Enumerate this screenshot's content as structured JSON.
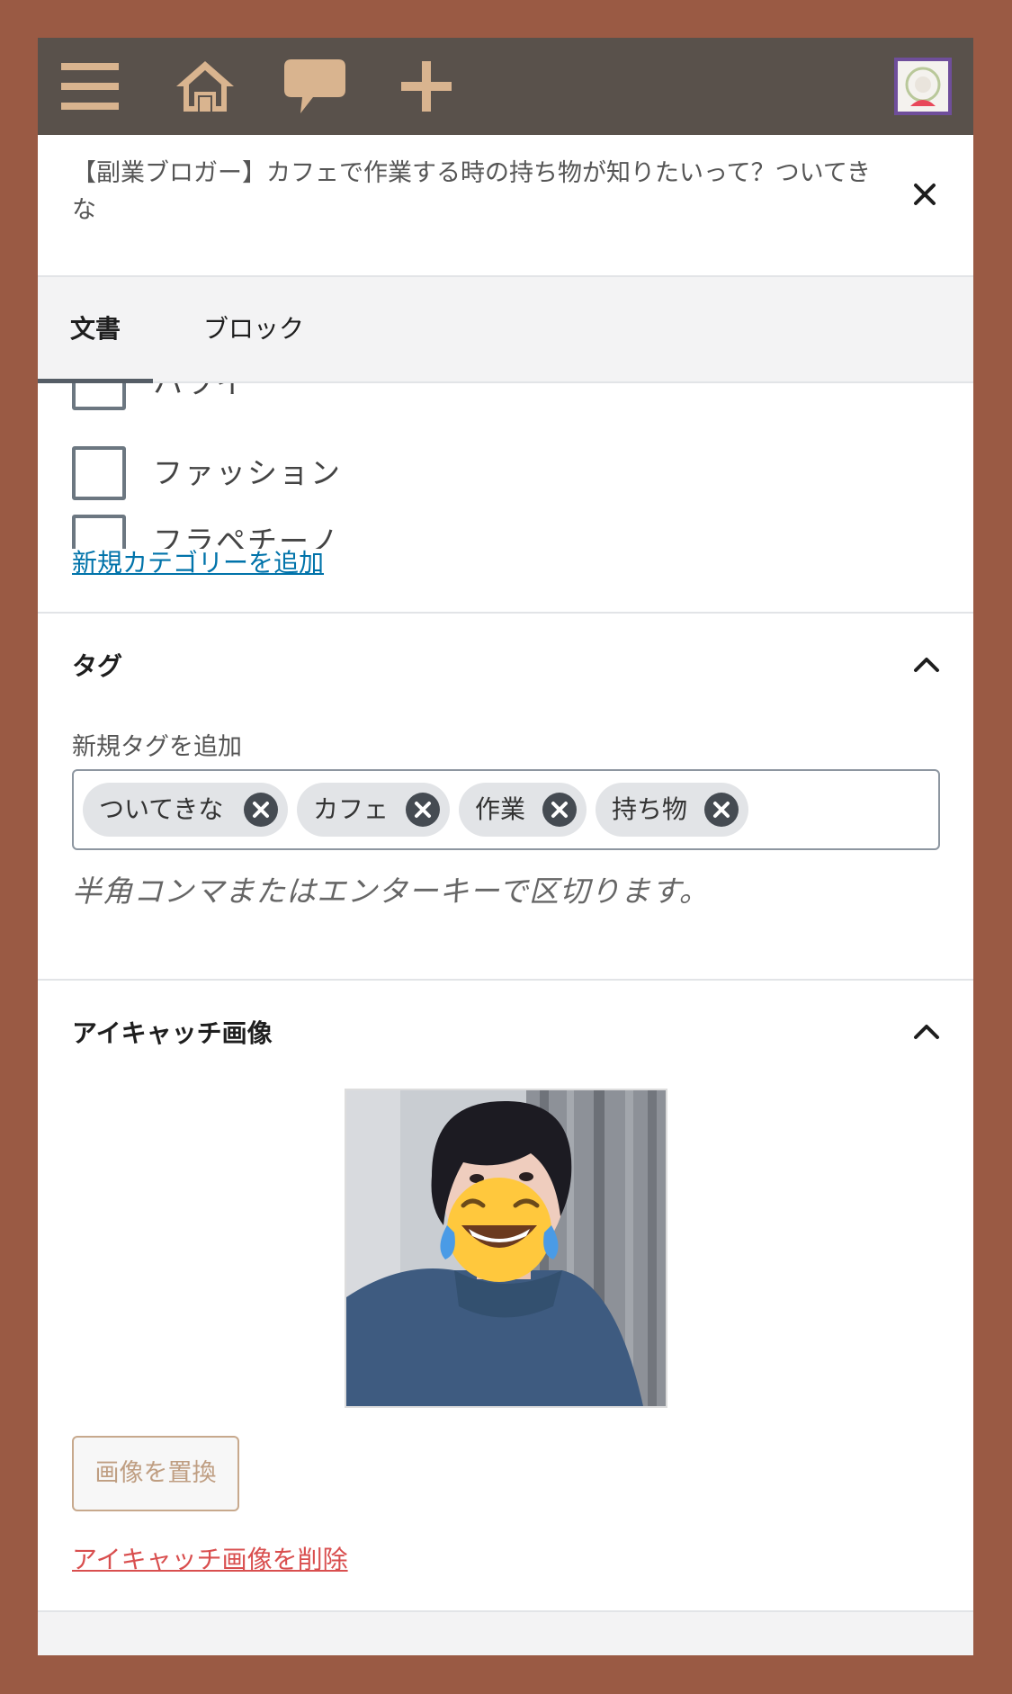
{
  "topbar": {
    "icons": [
      "menu-icon",
      "home-icon",
      "comment-icon",
      "plus-icon"
    ],
    "bg_color": "#59514b",
    "icon_color": "#d9b48f"
  },
  "post": {
    "title": "【副業ブロガー】カフェで作業する時の持ち物が知りたいって？ついてきな"
  },
  "tabs": [
    {
      "label": "文書",
      "active": true
    },
    {
      "label": "ブロック",
      "active": false
    }
  ],
  "categories": {
    "items": [
      {
        "label": "ハワイ",
        "checked": false
      },
      {
        "label": "ファッション",
        "checked": false
      },
      {
        "label": "フラペチーノ",
        "checked": false
      }
    ],
    "add_link": "新規カテゴリーを追加"
  },
  "tags_panel": {
    "title": "タグ",
    "field_label": "新規タグを追加",
    "tags": [
      "ついてきな",
      "カフェ",
      "作業",
      "持ち物"
    ],
    "hint": "半角コンマまたはエンターキーで区切ります。"
  },
  "featured_panel": {
    "title": "アイキャッチ画像",
    "replace_label": "画像を置換",
    "remove_label": "アイキャッチ画像を削除"
  },
  "colors": {
    "frame": "#9a5a44",
    "link": "#0073aa",
    "danger": "#d94f4f"
  }
}
